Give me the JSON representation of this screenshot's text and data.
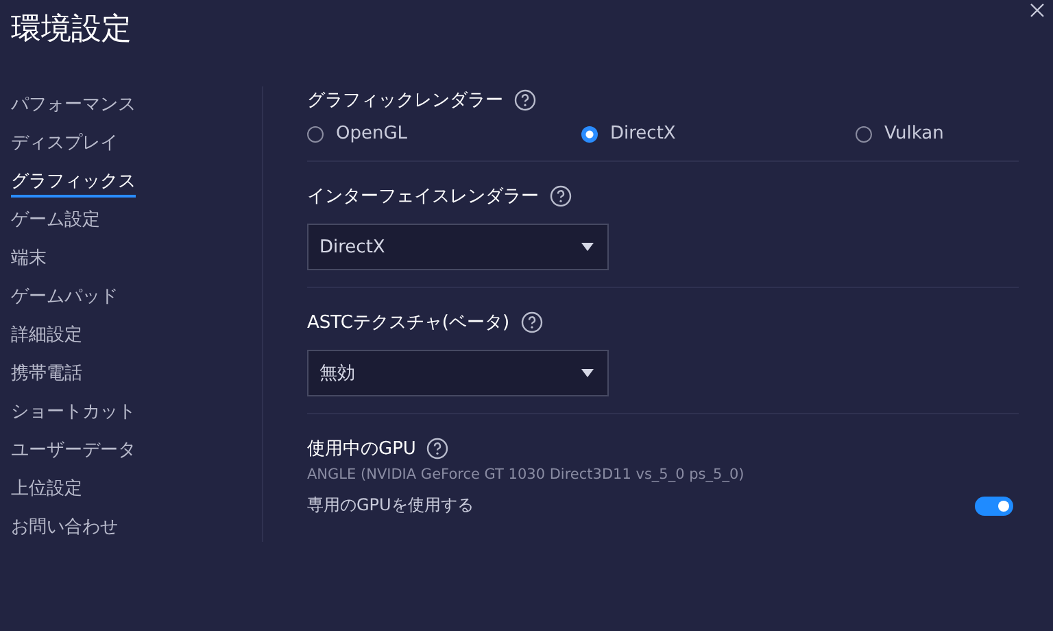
{
  "window": {
    "title": "環境設定"
  },
  "sidebar": {
    "items": [
      {
        "label": "パフォーマンス",
        "selected": false
      },
      {
        "label": "ディスプレイ",
        "selected": false
      },
      {
        "label": "グラフィックス",
        "selected": true
      },
      {
        "label": "ゲーム設定",
        "selected": false
      },
      {
        "label": "端末",
        "selected": false
      },
      {
        "label": "ゲームパッド",
        "selected": false
      },
      {
        "label": "詳細設定",
        "selected": false
      },
      {
        "label": "携帯電話",
        "selected": false
      },
      {
        "label": "ショートカット",
        "selected": false
      },
      {
        "label": "ユーザーデータ",
        "selected": false
      },
      {
        "label": "上位設定",
        "selected": false
      },
      {
        "label": "お問い合わせ",
        "selected": false
      }
    ]
  },
  "sections": [
    {
      "kind": "radio",
      "label": "グラフィックレンダラー",
      "options": [
        {
          "label": "OpenGL",
          "selected": false
        },
        {
          "label": "DirectX",
          "selected": true
        },
        {
          "label": "Vulkan",
          "selected": false
        }
      ]
    },
    {
      "kind": "dropdown",
      "label": "インターフェイスレンダラー",
      "value": "DirectX"
    },
    {
      "kind": "dropdown",
      "label": "ASTCテクスチャ(ベータ)",
      "value": "無効"
    },
    {
      "kind": "gpu",
      "label": "使用中のGPU",
      "detail": "ANGLE (NVIDIA GeForce GT 1030 Direct3D11 vs_5_0 ps_5_0)",
      "toggle": {
        "label": "専用のGPUを使用する",
        "on": true
      }
    }
  ]
}
